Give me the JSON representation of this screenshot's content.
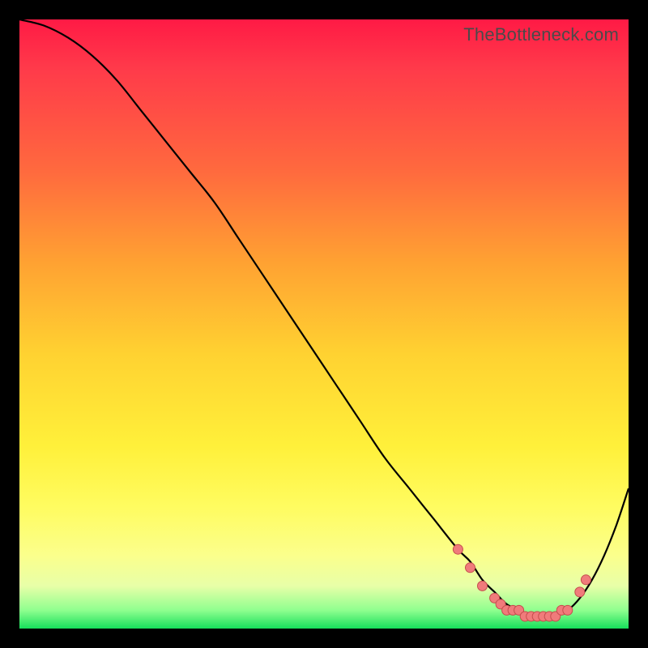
{
  "watermark": "TheBottleneck.com",
  "colors": {
    "curve_stroke": "#000000",
    "dot_fill": "#f07b7b",
    "dot_stroke": "#c54d4d"
  },
  "chart_data": {
    "type": "line",
    "title": "",
    "xlabel": "",
    "ylabel": "",
    "xlim": [
      0,
      100
    ],
    "ylim": [
      0,
      100
    ],
    "series": [
      {
        "name": "curve",
        "x": [
          0,
          4,
          8,
          12,
          16,
          20,
          24,
          28,
          32,
          36,
          40,
          44,
          48,
          52,
          56,
          60,
          64,
          68,
          72,
          74,
          76,
          78,
          80,
          82,
          84,
          86,
          88,
          90,
          92,
          94,
          96,
          98,
          100
        ],
        "y": [
          100,
          99,
          97,
          94,
          90,
          85,
          80,
          75,
          70,
          64,
          58,
          52,
          46,
          40,
          34,
          28,
          23,
          18,
          13,
          11,
          8,
          6,
          4,
          3,
          2,
          2,
          2,
          3,
          5,
          8,
          12,
          17,
          23
        ]
      }
    ],
    "markers": {
      "name": "optimum-band",
      "x": [
        72,
        74,
        76,
        78,
        79,
        80,
        81,
        82,
        83,
        84,
        85,
        86,
        87,
        88,
        89,
        90,
        92,
        93
      ],
      "y": [
        13,
        10,
        7,
        5,
        4,
        3,
        3,
        3,
        2,
        2,
        2,
        2,
        2,
        2,
        3,
        3,
        6,
        8
      ]
    }
  }
}
